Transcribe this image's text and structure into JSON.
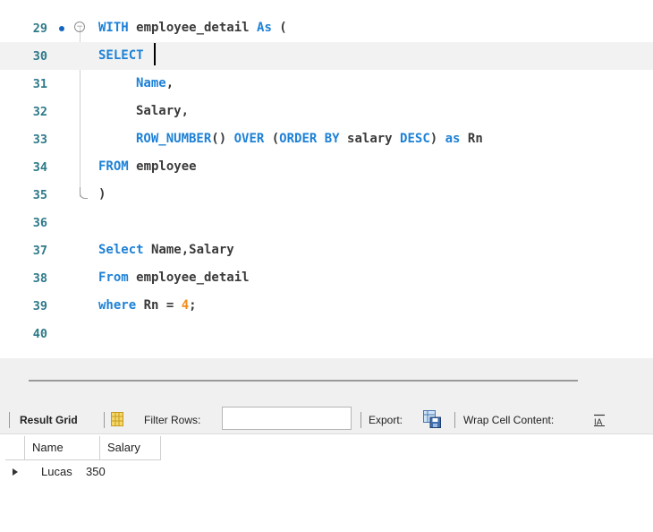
{
  "editor": {
    "lines": [
      {
        "num": "29"
      },
      {
        "num": "30"
      },
      {
        "num": "31"
      },
      {
        "num": "32"
      },
      {
        "num": "33"
      },
      {
        "num": "34"
      },
      {
        "num": "35"
      },
      {
        "num": "36"
      },
      {
        "num": "37"
      },
      {
        "num": "38"
      },
      {
        "num": "39"
      },
      {
        "num": "40"
      }
    ],
    "tokens": {
      "l29_kw1": "WITH",
      "l29_id": " employee_detail ",
      "l29_kw2": "As",
      "l29_pn": " (",
      "l30_kw": "SELECT",
      "l31_id": "Name",
      "l31_pn": ",",
      "l32_id": "Salary,",
      "l33_kw1": "ROW_NUMBER",
      "l33_pn1": "() ",
      "l33_kw2": "OVER",
      "l33_pn2": " (",
      "l33_kw3": "ORDER BY",
      "l33_id": " salary ",
      "l33_kw4": "DESC",
      "l33_pn3": ") ",
      "l33_kw5": "as",
      "l33_id2": " Rn",
      "l34_kw": "FROM",
      "l34_id": " employee",
      "l35_pn": ")",
      "l37_kw": "Select",
      "l37_id": " Name,Salary",
      "l38_kw": "From",
      "l38_id": " employee_detail",
      "l39_kw": "where",
      "l39_id": " Rn = ",
      "l39_num": "4",
      "l39_pn": ";"
    }
  },
  "toolbar": {
    "result_grid": "Result Grid",
    "filter_rows": "Filter Rows:",
    "filter_value": "",
    "export": "Export:",
    "wrap_cell": "Wrap Cell Content:"
  },
  "result": {
    "columns": [
      "Name",
      "Salary"
    ],
    "rows": [
      [
        "Lucas",
        "350"
      ]
    ]
  },
  "colors": {
    "keyword": "#1d81d6",
    "number": "#f18d1e",
    "line_number": "#2e7a88"
  }
}
